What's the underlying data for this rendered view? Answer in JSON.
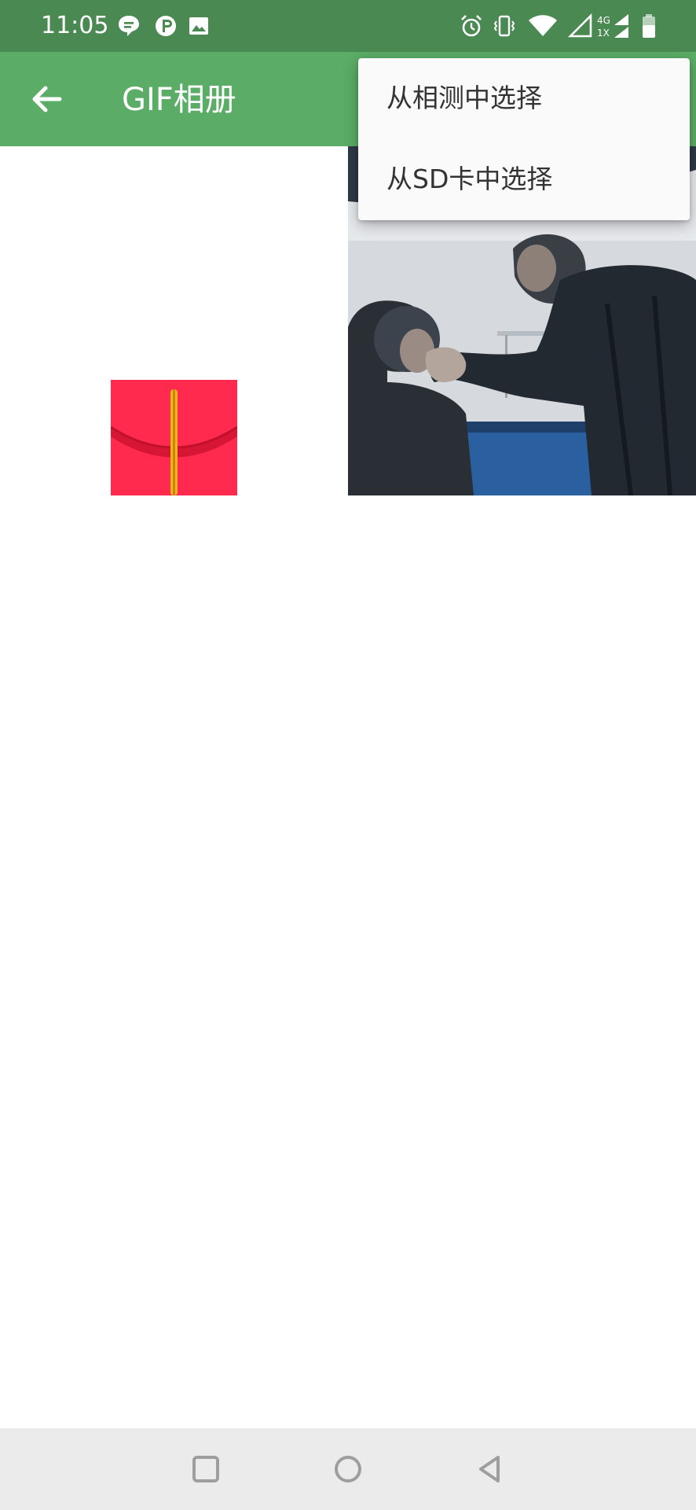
{
  "status_bar": {
    "time": "11:05",
    "left_icons": [
      "chat-bubble-icon",
      "parking-icon",
      "image-icon"
    ],
    "right_icons": [
      "alarm-icon",
      "vibrate-icon",
      "wifi-icon",
      "signal-icon",
      "network-4g-1x-icon",
      "battery-icon"
    ],
    "network_label_top": "4G",
    "network_label_bottom": "1X",
    "color": "#4a8a52"
  },
  "app_bar": {
    "title": "GIF相册",
    "back_icon": "arrow-left-icon",
    "color": "#5aac66"
  },
  "menu": {
    "items": [
      {
        "label": "从相测中选择"
      },
      {
        "label": "从SD卡中选择"
      }
    ]
  },
  "grid": {
    "items": [
      {
        "type": "red-envelope-gif"
      },
      {
        "type": "photo-gif"
      }
    ]
  },
  "nav_bar": {
    "buttons": [
      "recent-apps-icon",
      "home-icon",
      "back-triangle-icon"
    ],
    "color": "#ebebeb"
  }
}
